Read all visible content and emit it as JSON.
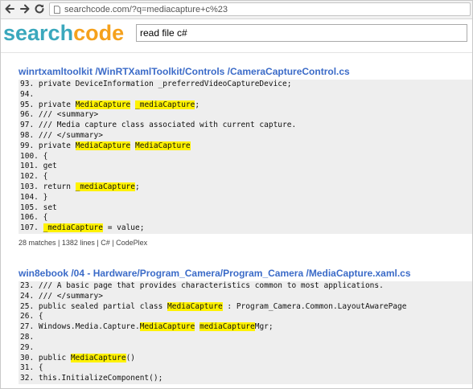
{
  "browser": {
    "url": "searchcode.com/?q=mediacapture+c%23"
  },
  "logo": {
    "part1": "search",
    "part2": "code"
  },
  "search": {
    "query": "read file c#"
  },
  "results": [
    {
      "title": "winrtxamltoolkit /WinRTXamlToolkit/Controls /CameraCaptureControl.cs",
      "lines": [
        [
          {
            "t": "93. private DeviceInformation _preferredVideoCaptureDevice;"
          }
        ],
        [
          {
            "t": "94."
          }
        ],
        [
          {
            "t": "95. private "
          },
          {
            "t": "MediaCapture",
            "h": true
          },
          {
            "t": " "
          },
          {
            "t": "_mediaCapture",
            "h": true
          },
          {
            "t": ";"
          }
        ],
        [
          {
            "t": "96. /// <summary>"
          }
        ],
        [
          {
            "t": "97. /// Media capture class associated with current capture."
          }
        ],
        [
          {
            "t": "98. /// </summary>"
          }
        ],
        [
          {
            "t": "99. private "
          },
          {
            "t": "MediaCapture",
            "h": true
          },
          {
            "t": " "
          },
          {
            "t": "MediaCapture",
            "h": true
          }
        ],
        [
          {
            "t": "100. {"
          }
        ],
        [
          {
            "t": "101. get"
          }
        ],
        [
          {
            "t": "102. {"
          }
        ],
        [
          {
            "t": "103. return "
          },
          {
            "t": "_mediaCapture",
            "h": true
          },
          {
            "t": ";"
          }
        ],
        [
          {
            "t": "104. }"
          }
        ],
        [
          {
            "t": "105. set"
          }
        ],
        [
          {
            "t": "106. {"
          }
        ],
        [
          {
            "t": "107. "
          },
          {
            "t": "_mediaCapture",
            "h": true
          },
          {
            "t": " = value;"
          }
        ]
      ],
      "meta": "28 matches | 1382 lines | C# | CodePlex"
    },
    {
      "title": "win8ebook /04 - Hardware/Program_Camera/Program_Camera /MediaCapture.xaml.cs",
      "lines": [
        [
          {
            "t": "23. /// A basic page that provides characteristics common to most applications."
          }
        ],
        [
          {
            "t": "24. /// </summary>"
          }
        ],
        [
          {
            "t": "25. public sealed partial class "
          },
          {
            "t": "MediaCapture",
            "h": true
          },
          {
            "t": " : Program_Camera.Common.LayoutAwarePage"
          }
        ],
        [
          {
            "t": "26. {"
          }
        ],
        [
          {
            "t": "27. Windows.Media.Capture."
          },
          {
            "t": "MediaCapture",
            "h": true
          },
          {
            "t": " "
          },
          {
            "t": "mediaCapture",
            "h": true
          },
          {
            "t": "Mgr;"
          }
        ],
        [
          {
            "t": "28."
          }
        ],
        [
          {
            "t": "29."
          }
        ],
        [
          {
            "t": "30. public "
          },
          {
            "t": "MediaCapture",
            "h": true
          },
          {
            "t": "()"
          }
        ],
        [
          {
            "t": "31. {"
          }
        ],
        [
          {
            "t": "32. this.InitializeComponent();"
          }
        ]
      ],
      "meta": ""
    }
  ]
}
